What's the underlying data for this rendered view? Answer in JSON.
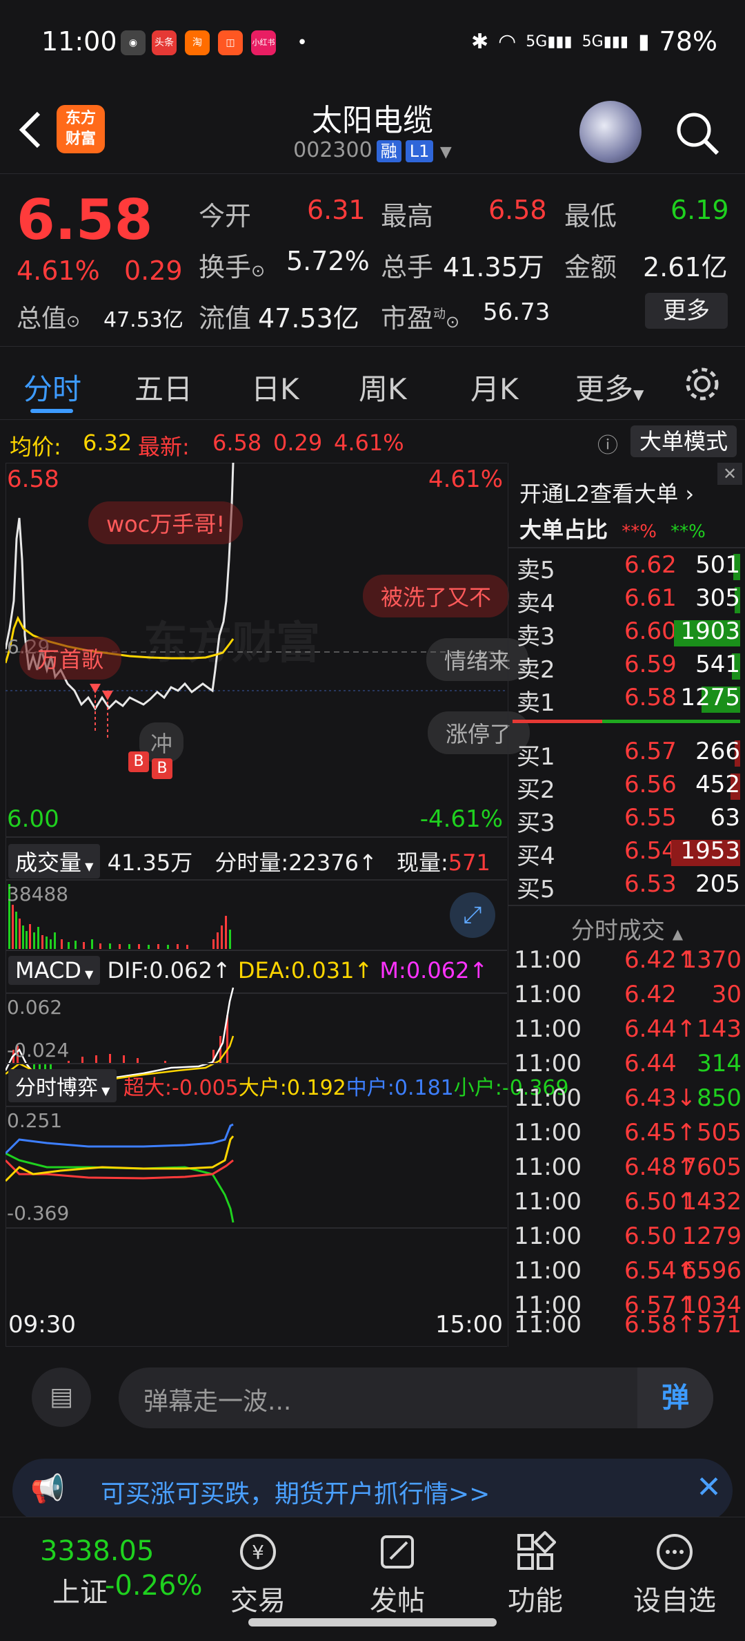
{
  "status": {
    "time": "11:00",
    "battery": "78%",
    "net1": "5G",
    "net2": "5G",
    "apps": [
      "头条",
      "淘",
      "小红书"
    ]
  },
  "header": {
    "title": "太阳电缆",
    "code": "002300",
    "tag_margin": "融",
    "tag_level": "L1",
    "logo": "东方\n财富"
  },
  "quote": {
    "price": "6.58",
    "pct": "4.61%",
    "chg": "0.29",
    "open_label": "今开",
    "open": "6.31",
    "high_label": "最高",
    "high": "6.58",
    "low_label": "最低",
    "low": "6.19",
    "turnover_label": "换手",
    "turnover": "5.72%",
    "vol_label": "总手",
    "vol": "41.35万",
    "amt_label": "金额",
    "amt": "2.61亿",
    "mktcap_label": "总值",
    "mktcap": "47.53亿",
    "float_label": "流值",
    "float": "47.53亿",
    "pe_label": "市盈",
    "pe_sup": "动",
    "pe": "56.73",
    "more": "更多"
  },
  "tabs": [
    "分时",
    "五日",
    "日K",
    "周K",
    "月K",
    "更多"
  ],
  "inforow": {
    "avg_label": "均价:",
    "avg": "6.32",
    "latest_label": "最新:",
    "latest": "6.58",
    "chg": "0.29",
    "pct": "4.61%",
    "mode_btn": "大单模式"
  },
  "chart": {
    "top_left": "6.58",
    "top_right": "4.61%",
    "bottom_left": "6.00",
    "bottom_right": "-4.61%",
    "mid": "6.29",
    "start_time": "09:30",
    "end_time": "15:00",
    "marker": "冲",
    "b1": "B",
    "b2": "B"
  },
  "bubbles": [
    "woc万手哥!",
    "被洗了又不",
    "万首歌",
    "情绪来",
    "涨停了"
  ],
  "volume": {
    "label": "成交量",
    "total": "41.35万",
    "fs_label": "分时量:22376↑",
    "now_label": "现量:",
    "now": "571",
    "max": "38488"
  },
  "macd": {
    "label": "MACD",
    "dif": "DIF:0.062↑",
    "dea": "DEA:0.031↑",
    "m": "M:0.062↑",
    "top": "0.062",
    "bottom": "-0.024"
  },
  "game": {
    "label": "分时博弈",
    "super": "超大:-0.005",
    "big": "大户:0.192",
    "mid": "中户:0.181",
    "small": "小户:-0.369",
    "top": "0.251",
    "bottom": "-0.369"
  },
  "rpanel": {
    "open_l2": "开通L2查看大单",
    "ratio_label": "大单占比",
    "ratio_red": "**%",
    "ratio_green": "**%",
    "trades_title": "分时成交"
  },
  "asks": [
    {
      "l": "卖5",
      "p": "6.62",
      "v": "501"
    },
    {
      "l": "卖4",
      "p": "6.61",
      "v": "305"
    },
    {
      "l": "卖3",
      "p": "6.60",
      "v": "1903"
    },
    {
      "l": "卖2",
      "p": "6.59",
      "v": "541"
    },
    {
      "l": "卖1",
      "p": "6.58",
      "v": "1275"
    }
  ],
  "bids": [
    {
      "l": "买1",
      "p": "6.57",
      "v": "266"
    },
    {
      "l": "买2",
      "p": "6.56",
      "v": "452"
    },
    {
      "l": "买3",
      "p": "6.55",
      "v": "63"
    },
    {
      "l": "买4",
      "p": "6.54",
      "v": "1953"
    },
    {
      "l": "买5",
      "p": "6.53",
      "v": "205"
    }
  ],
  "trades": [
    {
      "t": "11:00",
      "p": "6.42↑",
      "v": "1370"
    },
    {
      "t": "11:00",
      "p": "6.42",
      "v": "30"
    },
    {
      "t": "11:00",
      "p": "6.44↑",
      "v": "143"
    },
    {
      "t": "11:00",
      "p": "6.44",
      "v": "314"
    },
    {
      "t": "11:00",
      "p": "6.43↓",
      "v": "850"
    },
    {
      "t": "11:00",
      "p": "6.45↑",
      "v": "505"
    },
    {
      "t": "11:00",
      "p": "6.48↑",
      "v": "7605"
    },
    {
      "t": "11:00",
      "p": "6.50↑",
      "v": "1432"
    },
    {
      "t": "11:00",
      "p": "6.50",
      "v": "1279"
    },
    {
      "t": "11:00",
      "p": "6.54↑",
      "v": "6596"
    },
    {
      "t": "11:00",
      "p": "6.57↑",
      "v": "1034"
    },
    {
      "t": "11:00",
      "p": "6.58↑",
      "v": "571"
    }
  ],
  "comment": {
    "placeholder": "弹幕走一波...",
    "danmu": "弹"
  },
  "ad": {
    "text": "可买涨可买跌，期货开户抓行情>>"
  },
  "nav": {
    "index_val": "3338.05",
    "index_name": "上证",
    "index_chg": "-0.26%",
    "items": [
      "交易",
      "发帖",
      "功能",
      "设自选"
    ]
  },
  "colors": {
    "up": "#ff3b3b",
    "down": "#1fd11f",
    "accent": "#3d9bff",
    "avg_line": "#ffd600"
  }
}
